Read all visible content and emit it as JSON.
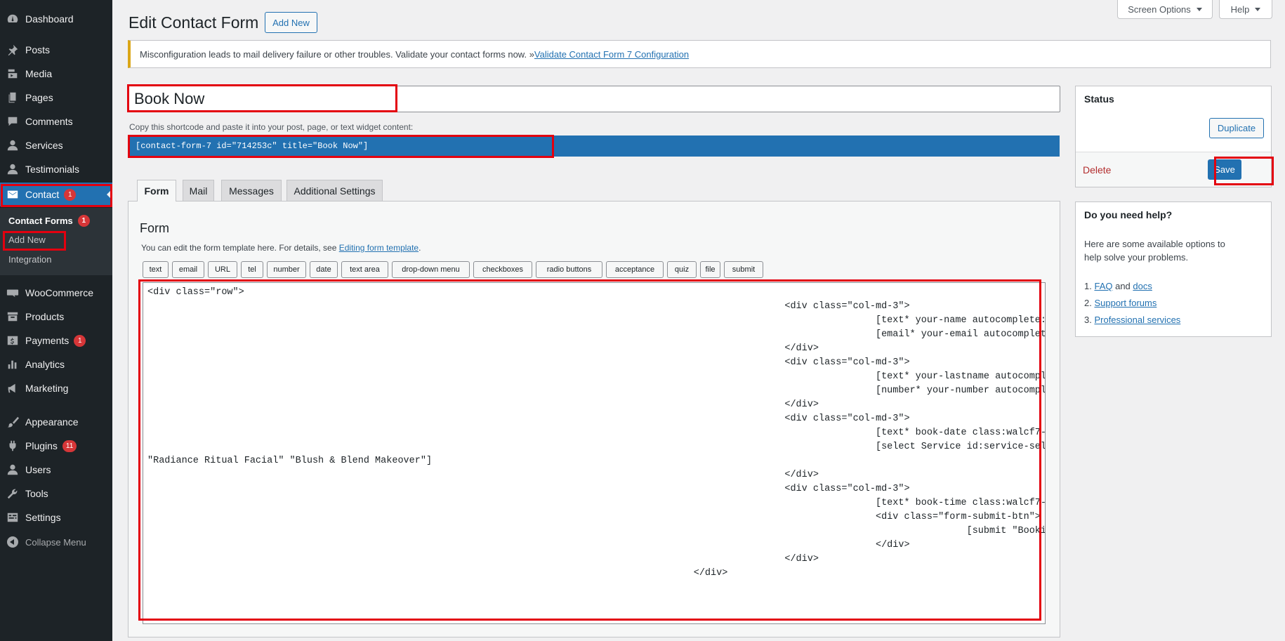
{
  "sidebar": {
    "items": [
      {
        "name": "dashboard",
        "label": "Dashboard",
        "icon": "dashboard-icon",
        "badge": ""
      },
      {
        "name": "posts",
        "label": "Posts",
        "icon": "pin-icon",
        "badge": ""
      },
      {
        "name": "media",
        "label": "Media",
        "icon": "media-icon",
        "badge": ""
      },
      {
        "name": "pages",
        "label": "Pages",
        "icon": "pages-icon",
        "badge": ""
      },
      {
        "name": "comments",
        "label": "Comments",
        "icon": "comment-icon",
        "badge": ""
      },
      {
        "name": "services",
        "label": "Services",
        "icon": "user-icon",
        "badge": ""
      },
      {
        "name": "testimonials",
        "label": "Testimonials",
        "icon": "user-icon",
        "badge": ""
      },
      {
        "name": "contact",
        "label": "Contact",
        "icon": "mail-icon",
        "badge": "1"
      },
      {
        "name": "woocommerce",
        "label": "WooCommerce",
        "icon": "woo-icon",
        "badge": ""
      },
      {
        "name": "products",
        "label": "Products",
        "icon": "archive-icon",
        "badge": ""
      },
      {
        "name": "payments",
        "label": "Payments",
        "icon": "dollar-icon",
        "badge": "1"
      },
      {
        "name": "analytics",
        "label": "Analytics",
        "icon": "chart-icon",
        "badge": ""
      },
      {
        "name": "marketing",
        "label": "Marketing",
        "icon": "megaphone-icon",
        "badge": ""
      },
      {
        "name": "appearance",
        "label": "Appearance",
        "icon": "brush-icon",
        "badge": ""
      },
      {
        "name": "plugins",
        "label": "Plugins",
        "icon": "plug-icon",
        "badge": "11"
      },
      {
        "name": "users",
        "label": "Users",
        "icon": "user-icon",
        "badge": ""
      },
      {
        "name": "tools",
        "label": "Tools",
        "icon": "wrench-icon",
        "badge": ""
      },
      {
        "name": "settings",
        "label": "Settings",
        "icon": "settings-icon",
        "badge": ""
      }
    ],
    "submenu": {
      "contact_forms": "Contact Forms",
      "contact_forms_badge": "1",
      "add_new": "Add New",
      "integration": "Integration"
    },
    "collapse": "Collapse Menu"
  },
  "header": {
    "screen_options": "Screen Options",
    "help": "Help",
    "title": "Edit Contact Form",
    "add_new": "Add New"
  },
  "notice": {
    "text": "Misconfiguration leads to mail delivery failure or other troubles. Validate your contact forms now. » ",
    "link": "Validate Contact Form 7 Configuration"
  },
  "form_title": "Book Now",
  "shortcode": {
    "label": "Copy this shortcode and paste it into your post, page, or text widget content:",
    "value": "[contact-form-7 id=\"714253c\" title=\"Book Now\"]"
  },
  "tabs": [
    "Form",
    "Mail",
    "Messages",
    "Additional Settings"
  ],
  "form_panel": {
    "heading": "Form",
    "desc": "You can edit the form template here. For details, see ",
    "desc_link": "Editing form template",
    "desc_end": ".",
    "tags": [
      "text",
      "email",
      "URL",
      "tel",
      "number",
      "date",
      "text area",
      "drop-down menu",
      "checkboxes",
      "radio buttons",
      "acceptance",
      "quiz",
      "file",
      "submit"
    ],
    "template": "<div class=\"row\">\n\t\t\t\t\t\t\t\t\t\t\t\t\t\t<div class=\"col-md-3\">\n\t\t\t\t\t\t\t\t\t\t\t\t\t\t\t\t[text* your-name autocomplete:name placeholder \"First Name\"]\n\t\t\t\t\t\t\t\t\t\t\t\t\t\t\t\t[email* your-email autocomplete:email placeholder \"Email\"]\n\t\t\t\t\t\t\t\t\t\t\t\t\t\t</div>\n\t\t\t\t\t\t\t\t\t\t\t\t\t\t<div class=\"col-md-3\">\n\t\t\t\t\t\t\t\t\t\t\t\t\t\t\t\t[text* your-lastname autocomplete:name placeholder \"Last Name\"]\n\t\t\t\t\t\t\t\t\t\t\t\t\t\t\t\t[number* your-number autocomplete:number placeholder \"Phone no\"]\n\t\t\t\t\t\t\t\t\t\t\t\t\t\t</div>\n\t\t\t\t\t\t\t\t\t\t\t\t\t\t<div class=\"col-md-3\">\n\t\t\t\t\t\t\t\t\t\t\t\t\t\t\t\t[text* book-date class:walcf7-datepicker placeholder \"Select Date\"]\n\t\t\t\t\t\t\t\t\t\t\t\t\t\t\t\t[select Service id:service-select \"Service\" \"Glow & Go Facial\" \"Skin Touch Waxing\"\n\"Radiance Ritual Facial\" \"Blush & Blend Makeover\"]\n\t\t\t\t\t\t\t\t\t\t\t\t\t\t</div>\n\t\t\t\t\t\t\t\t\t\t\t\t\t\t<div class=\"col-md-3\">\n\t\t\t\t\t\t\t\t\t\t\t\t\t\t\t\t[text* book-time class:walcf7-timepicker placeholder \"Select Time\"]\n\t\t\t\t\t\t\t\t\t\t\t\t\t\t\t\t<div class=\"form-submit-btn\">\n\t\t\t\t\t\t\t\t\t\t\t\t\t\t\t\t\t\t[submit \"Booking Now\"]\n\t\t\t\t\t\t\t\t\t\t\t\t\t\t\t\t</div>\n\t\t\t\t\t\t\t\t\t\t\t\t\t\t</div>\n\t\t\t\t\t\t\t\t\t\t\t\t</div>"
  },
  "status_box": {
    "title": "Status",
    "duplicate": "Duplicate",
    "delete": "Delete",
    "save": "Save"
  },
  "help_box": {
    "title": "Do you need help?",
    "text": "Here are some available options to help solve your problems.",
    "items": [
      {
        "num": "1.",
        "link": "FAQ",
        "mid": " and ",
        "link2": "docs"
      },
      {
        "num": "2.",
        "link": "Support forums"
      },
      {
        "num": "3.",
        "link": "Professional services"
      }
    ]
  },
  "colors": {
    "sidebar_bg": "#1d2327",
    "accent": "#2271b1",
    "badge": "#d63638",
    "highlight": "#e3000f",
    "notice_border": "#dba617"
  }
}
